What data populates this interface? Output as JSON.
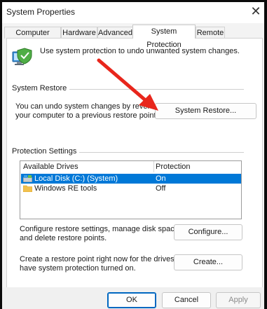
{
  "window": {
    "title": "System Properties"
  },
  "tabs": [
    {
      "label": "Computer Name"
    },
    {
      "label": "Hardware"
    },
    {
      "label": "Advanced"
    },
    {
      "label": "System Protection"
    },
    {
      "label": "Remote"
    }
  ],
  "intro_text": "Use system protection to undo unwanted system changes.",
  "system_restore": {
    "group_label": "System Restore",
    "description_line1": "You can undo system changes by reverting",
    "description_line2": "your computer to a previous restore point.",
    "button_label": "System Restore..."
  },
  "protection_settings": {
    "group_label": "Protection Settings",
    "columns": [
      "Available Drives",
      "Protection"
    ],
    "drives": [
      {
        "name": "Local Disk (C:) (System)",
        "protection": "On",
        "selected": true,
        "icon": "system-drive-icon"
      },
      {
        "name": "Windows RE tools",
        "protection": "Off",
        "selected": false,
        "icon": "folder-icon"
      }
    ],
    "configure_text_line1": "Configure restore settings, manage disk space,",
    "configure_text_line2": "and delete restore points.",
    "configure_button": "Configure...",
    "create_text_line1": "Create a restore point right now for the drives that",
    "create_text_line2": "have system protection turned on.",
    "create_button": "Create..."
  },
  "footer": {
    "ok": "OK",
    "cancel": "Cancel",
    "apply": "Apply"
  },
  "colors": {
    "selection": "#0078d7",
    "annotation_arrow": "#e8261c"
  }
}
